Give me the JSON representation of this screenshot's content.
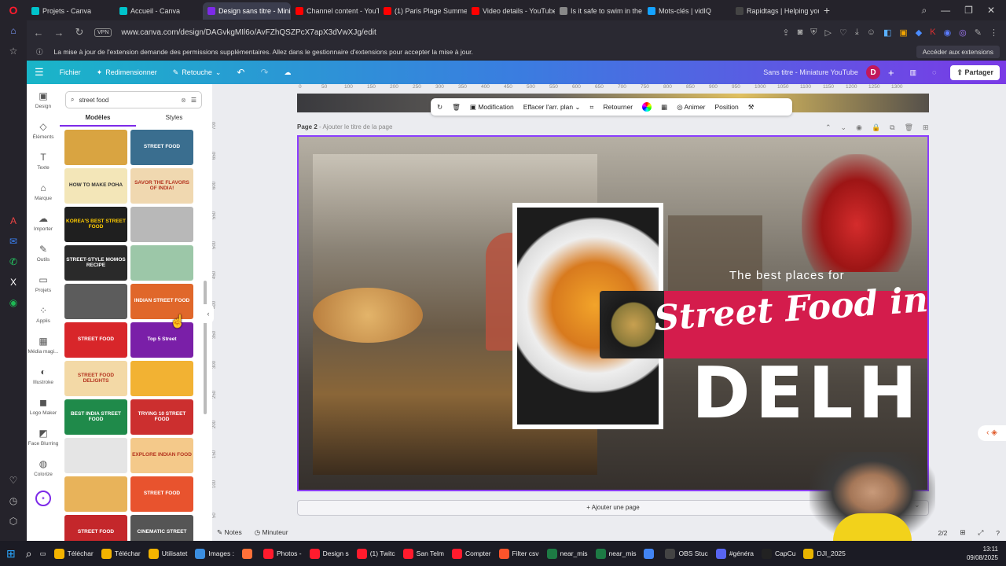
{
  "browser": {
    "tabs": [
      {
        "label": "Projets - Canva",
        "color": "#00c4cc",
        "active": false
      },
      {
        "label": "Accueil - Canva",
        "color": "#00c4cc",
        "active": false
      },
      {
        "label": "Design sans titre - Miniat",
        "color": "#7d2ae8",
        "active": true
      },
      {
        "label": "Channel content - YouTube",
        "color": "#ff0000",
        "active": false
      },
      {
        "label": "(1) Paris Plage Summer To",
        "color": "#ff0000",
        "active": false
      },
      {
        "label": "Video details - YouTube St",
        "color": "#ff0000",
        "active": false
      },
      {
        "label": "Is it safe to swim in the Se",
        "color": "#888888",
        "active": false
      },
      {
        "label": "Mots-clés | vidIQ",
        "color": "#14a3ff",
        "active": false
      },
      {
        "label": "Rapidtags | Helping you g",
        "color": "#444444",
        "active": false
      }
    ],
    "url": "www.canva.com/design/DAGvkgMIl6o/AvFZhQSZPcX7apX3dVwXJg/edit",
    "vpn_label": "VPN",
    "infobar_text": "La mise à jour de l'extension demande des permissions supplémentaires. Allez dans le gestionnaire d'extensions pour accepter la mise à jour.",
    "infobar_button": "Accéder aux extensions"
  },
  "canva_header": {
    "file": "Fichier",
    "resize": "Redimensionner",
    "retouch": "Retouche",
    "doc_title": "Sans titre - Miniature YouTube",
    "avatar_letter": "D",
    "share": "Partager"
  },
  "rail": [
    {
      "label": "Design",
      "icon": "▣"
    },
    {
      "label": "Éléments",
      "icon": "◇"
    },
    {
      "label": "Texte",
      "icon": "T"
    },
    {
      "label": "Marque",
      "icon": "⌂"
    },
    {
      "label": "Importer",
      "icon": "☁"
    },
    {
      "label": "Outils",
      "icon": "✎"
    },
    {
      "label": "Projets",
      "icon": "▭"
    },
    {
      "label": "Applis",
      "icon": "⁘"
    },
    {
      "label": "Média magi...",
      "icon": "▦"
    },
    {
      "label": "Illustroke",
      "icon": "◐"
    },
    {
      "label": "Logo Maker",
      "icon": "◼"
    },
    {
      "label": "Face Blurring",
      "icon": "◩"
    },
    {
      "label": "Colorize",
      "icon": "◍"
    }
  ],
  "panel": {
    "search_value": "street food",
    "tab_templates": "Modèles",
    "tab_styles": "Styles",
    "thumbs": [
      {
        "text": "",
        "bg": "#d9a441"
      },
      {
        "text": "STREET FOOD",
        "bg": "#3a6e8f"
      },
      {
        "text": "HOW TO MAKE POHA",
        "bg": "#f3e6b8",
        "fg": "#333"
      },
      {
        "text": "SAVOR THE FLAVORS OF INDIA!",
        "bg": "#f0d8b0",
        "fg": "#b4341f"
      },
      {
        "text": "KOREA'S BEST STREET FOOD",
        "bg": "#1f1f1f",
        "fg": "#ffcc00"
      },
      {
        "text": "",
        "bg": "#b8b8b8"
      },
      {
        "text": "STREET-STYLE MOMOS RECIPE",
        "bg": "#2a2a2a"
      },
      {
        "text": "",
        "bg": "#9cc7a8"
      },
      {
        "text": "",
        "bg": "#5c5c5c"
      },
      {
        "text": "INDIAN STREET FOOD",
        "bg": "#e0672a"
      },
      {
        "text": "STREET FOOD",
        "bg": "#d8262a"
      },
      {
        "text": "Top 5 Street",
        "bg": "#7a1fa8"
      },
      {
        "text": "STREET FOOD DELIGHTS",
        "bg": "#f3d9a6",
        "fg": "#b4341f"
      },
      {
        "text": "",
        "bg": "#f2b233"
      },
      {
        "text": "BEST INDIA STREET FOOD",
        "bg": "#1f8a4a"
      },
      {
        "text": "TRYING 10 STREET FOOD",
        "bg": "#cc2f2f"
      },
      {
        "text": "",
        "bg": "#e5e5e5"
      },
      {
        "text": "EXPLORE INDIAN FOOD",
        "bg": "#f4c98a",
        "fg": "#b4341f"
      },
      {
        "text": "",
        "bg": "#e8b35a"
      },
      {
        "text": "STREET FOOD",
        "bg": "#e8532e"
      },
      {
        "text": "STREET FOOD",
        "bg": "#c4272b"
      },
      {
        "text": "CINEMATIC STREET",
        "bg": "#555555"
      }
    ]
  },
  "toolbar": {
    "edit": "Modification",
    "bg_remove": "Effacer l'arr. plan",
    "flip": "Retourner",
    "animate": "Animer",
    "position": "Position"
  },
  "page": {
    "label": "Page 2",
    "label_hint": "- Ajouter le titre de la page",
    "subtitle": "The best places for",
    "headline": "Street Food in",
    "city": "DELHI",
    "accent": "#d41c4c"
  },
  "add_page": "+ Ajouter une page",
  "footer": {
    "notes": "Notes",
    "timer": "Minuteur",
    "page_count": "2/2"
  },
  "ruler": [
    "0",
    "50",
    "100",
    "150",
    "200",
    "250",
    "300",
    "350",
    "400",
    "450",
    "500",
    "550",
    "600",
    "650",
    "700",
    "750",
    "800",
    "850",
    "900",
    "950",
    "1000",
    "1050",
    "1100",
    "1150",
    "1200",
    "1250",
    "1300"
  ],
  "ruler_left": [
    "700",
    "650",
    "600",
    "550",
    "500",
    "450",
    "400",
    "350",
    "300",
    "250",
    "200",
    "150",
    "100",
    "50"
  ],
  "taskbar": {
    "items": [
      {
        "label": "Téléchar",
        "color": "#f4b400"
      },
      {
        "label": "Téléchar",
        "color": "#f4b400"
      },
      {
        "label": "Utilisatet",
        "color": "#f4b400"
      },
      {
        "label": "Images :",
        "color": "#3b8ee0"
      },
      {
        "label": "",
        "color": "#ff7139"
      },
      {
        "label": "Photos -",
        "color": "#ff1b2d"
      },
      {
        "label": "Design s",
        "color": "#ff1b2d"
      },
      {
        "label": "(1) Twitc",
        "color": "#ff1b2d"
      },
      {
        "label": "San Telm",
        "color": "#ff1b2d"
      },
      {
        "label": "Compter",
        "color": "#ff1b2d"
      },
      {
        "label": "Filter csv",
        "color": "#fb542b"
      },
      {
        "label": "near_mis",
        "color": "#1d7a44"
      },
      {
        "label": "near_mis",
        "color": "#1d7a44"
      },
      {
        "label": "",
        "color": "#4285f4"
      },
      {
        "label": "OBS Stuc",
        "color": "#444444"
      },
      {
        "label": "#généra",
        "color": "#5865f2"
      },
      {
        "label": "CapCu",
        "color": "#222222"
      },
      {
        "label": "DJI_2025",
        "color": "#e8b400"
      }
    ],
    "time": "13:11",
    "date": "09/08/2025"
  }
}
